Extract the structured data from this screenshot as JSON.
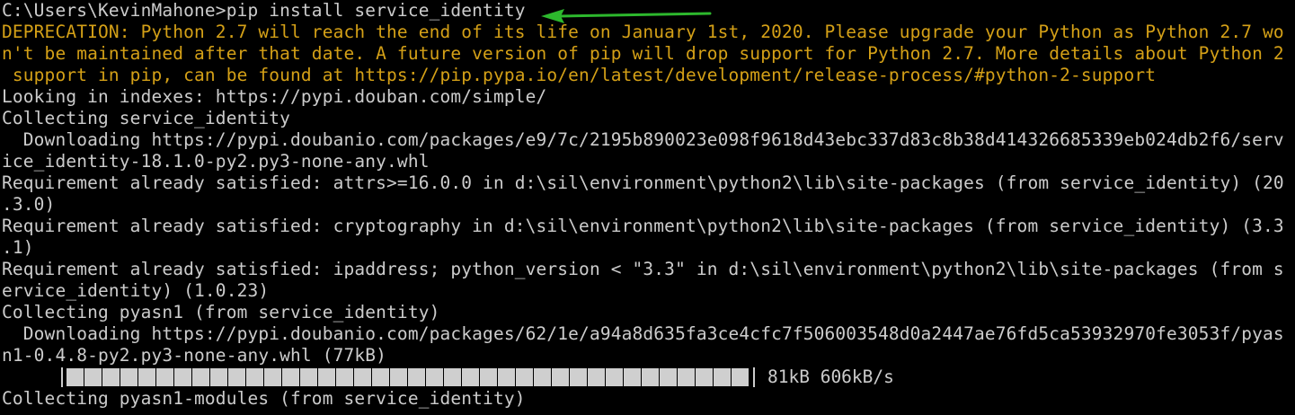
{
  "terminal": {
    "lines": [
      {
        "text": "C:\\Users\\KevinMahone>pip install service_identity",
        "style": "normal"
      },
      {
        "text": "DEPRECATION: Python 2.7 will reach the end of its life on January 1st, 2020. Please upgrade your Python as Python 2.7 wo",
        "style": "warn"
      },
      {
        "text": "n't be maintained after that date. A future version of pip will drop support for Python 2.7. More details about Python 2",
        "style": "warn"
      },
      {
        "text": " support in pip, can be found at https://pip.pypa.io/en/latest/development/release-process/#python-2-support",
        "style": "warn"
      },
      {
        "text": "Looking in indexes: https://pypi.douban.com/simple/",
        "style": "normal"
      },
      {
        "text": "Collecting service_identity",
        "style": "normal"
      },
      {
        "text": "  Downloading https://pypi.doubanio.com/packages/e9/7c/2195b890023e098f9618d43ebc337d83c8b38d414326685339eb024db2f6/serv",
        "style": "normal"
      },
      {
        "text": "ice_identity-18.1.0-py2.py3-none-any.whl",
        "style": "normal"
      },
      {
        "text": "Requirement already satisfied: attrs>=16.0.0 in d:\\sil\\environment\\python2\\lib\\site-packages (from service_identity) (20",
        "style": "normal"
      },
      {
        "text": ".3.0)",
        "style": "normal"
      },
      {
        "text": "Requirement already satisfied: cryptography in d:\\sil\\environment\\python2\\lib\\site-packages (from service_identity) (3.3",
        "style": "normal"
      },
      {
        "text": ".1)",
        "style": "normal"
      },
      {
        "text": "Requirement already satisfied: ipaddress; python_version < \"3.3\" in d:\\sil\\environment\\python2\\lib\\site-packages (from s",
        "style": "normal"
      },
      {
        "text": "ervice_identity) (1.0.23)",
        "style": "normal"
      },
      {
        "text": "Collecting pyasn1 (from service_identity)",
        "style": "normal"
      },
      {
        "text": "  Downloading https://pypi.doubanio.com/packages/62/1e/a94a8d635fa3ce4cfc7f506003548d0a2447ae76fd5ca53932970fe3053f/pyas",
        "style": "normal"
      },
      {
        "text": "n1-0.4.8-py2.py3-none-any.whl (77kB)",
        "style": "normal"
      }
    ],
    "progress": {
      "fraction": 1.0,
      "status": "81kB 606kB/s"
    },
    "last_line": "Collecting pyasn1-modules (from service_identity)"
  },
  "colors": {
    "background": "#000000",
    "text": "#cccccc",
    "warning": "#d4a017",
    "arrow": "#2db82d"
  },
  "annotations": {
    "arrow_icon": "green-arrow-icon"
  }
}
